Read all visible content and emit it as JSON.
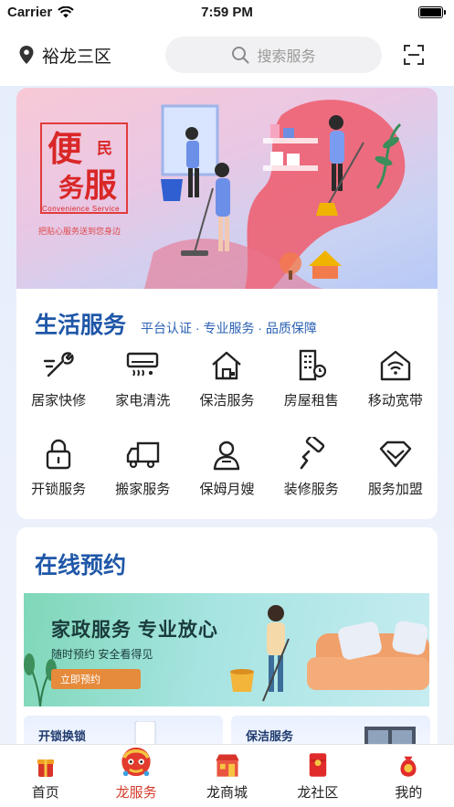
{
  "status_bar": {
    "carrier": "Carrier",
    "time": "7:59 PM"
  },
  "header": {
    "location": "裕龙三区",
    "search_placeholder": "搜索服务"
  },
  "banner": {
    "title_1": "便",
    "title_2": "民",
    "title_3": "务",
    "title_4": "服",
    "english": "Convenience Service",
    "slogan": "把贴心服务送到您身边"
  },
  "life_services": {
    "title": "生活服务",
    "subtitle": "平台认证 · 专业服务 · 品质保障",
    "items": [
      {
        "label": "居家快修",
        "icon": "tools-icon"
      },
      {
        "label": "家电清洗",
        "icon": "air-conditioner-icon"
      },
      {
        "label": "保洁服务",
        "icon": "house-icon"
      },
      {
        "label": "房屋租售",
        "icon": "building-key-icon"
      },
      {
        "label": "移动宽带",
        "icon": "wifi-home-icon"
      },
      {
        "label": "开锁服务",
        "icon": "lock-icon"
      },
      {
        "label": "搬家服务",
        "icon": "truck-icon"
      },
      {
        "label": "保姆月嫂",
        "icon": "nanny-icon"
      },
      {
        "label": "装修服务",
        "icon": "paint-roller-icon"
      },
      {
        "label": "服务加盟",
        "icon": "diamond-icon"
      }
    ]
  },
  "online_booking": {
    "title": "在线预约",
    "banner_title": "家政服务  专业放心",
    "banner_sub": "随时预约 安全看得见",
    "banner_button": "立即预约",
    "card_left": "开锁换锁",
    "card_right": "保洁服务"
  },
  "tabbar": {
    "items": [
      {
        "label": "首页",
        "icon": "home-gift-icon",
        "active": false
      },
      {
        "label": "龙服务",
        "icon": "dragon-icon",
        "active": true
      },
      {
        "label": "龙商城",
        "icon": "shop-icon",
        "active": false
      },
      {
        "label": "龙社区",
        "icon": "red-envelope-icon",
        "active": false
      },
      {
        "label": "我的",
        "icon": "money-bag-icon",
        "active": false
      }
    ]
  },
  "colors": {
    "accent": "#1f57a8",
    "tab_active": "#d43a2a"
  }
}
